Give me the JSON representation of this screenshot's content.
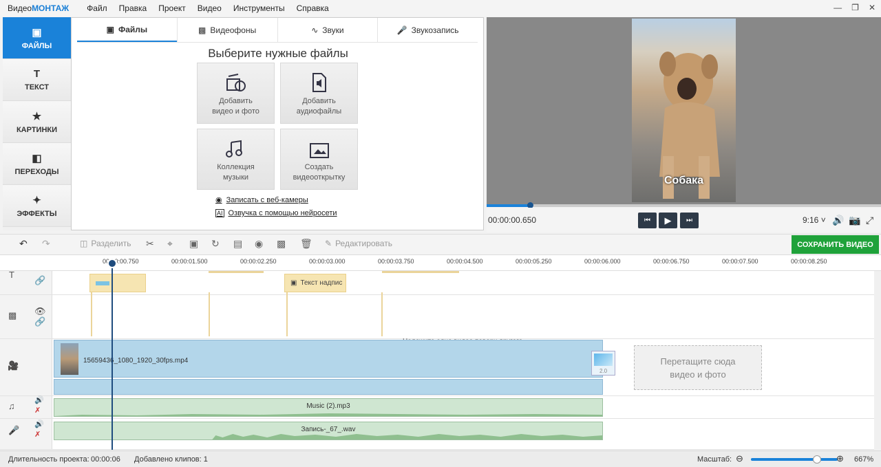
{
  "app": {
    "logo_a": "Видео",
    "logo_b": "МОНТАЖ"
  },
  "menu": [
    "Файл",
    "Правка",
    "Проект",
    "Видео",
    "Инструменты",
    "Справка"
  ],
  "sidetabs": [
    {
      "label": "ФАЙЛЫ",
      "icon": "image-icon"
    },
    {
      "label": "ТЕКСТ",
      "icon": "text-icon"
    },
    {
      "label": "КАРТИНКИ",
      "icon": "star-icon"
    },
    {
      "label": "ПЕРЕХОДЫ",
      "icon": "transition-icon"
    },
    {
      "label": "ЭФФЕКТЫ",
      "icon": "magic-wand-icon"
    }
  ],
  "filetabs": [
    "Файлы",
    "Видеофоны",
    "Звуки",
    "Звукозапись"
  ],
  "files": {
    "title": "Выберите нужные файлы",
    "tiles": [
      {
        "line1": "Добавить",
        "line2": "видео и фото"
      },
      {
        "line1": "Добавить",
        "line2": "аудиофайлы"
      },
      {
        "line1": "Коллекция",
        "line2": "музыки"
      },
      {
        "line1": "Создать",
        "line2": "видеооткрытку"
      }
    ],
    "link_webcam": "Записать с веб-камеры",
    "link_voice": "Озвучка с помощью нейросети"
  },
  "preview": {
    "caption": "Собака",
    "timecode": "00:00:00.650",
    "ratio": "9:16",
    "progress": 0.11
  },
  "toolbar": {
    "split": "Разделить",
    "edit": "Редактировать",
    "save": "СОХРАНИТЬ ВИДЕО"
  },
  "ruler": [
    "00:00:00.750",
    "00:00:01.500",
    "00:00:02.250",
    "00:00:03.000",
    "00:00:03.750",
    "00:00:04.500",
    "00:00:05.250",
    "00:00:06.000",
    "00:00:06.750",
    "00:00:07.500",
    "00:00:08.250"
  ],
  "tracks": {
    "text_clip": "Текст надпис",
    "overlay_hint": "Наложите одно видео поверх другого",
    "video_clip": "15659436_1080_1920_30fps.mp4",
    "transition_value": "2.0",
    "drop_line1": "Перетащите сюда",
    "drop_line2": "видео и фото",
    "music_clip": "Music (2).mp3",
    "voice_clip": "Запись-_67_.wav"
  },
  "status": {
    "duration_label": "Длительность проекта:",
    "duration": "00:00:06",
    "clips": "Добавлено клипов: 1",
    "zoom_label": "Масштаб:",
    "zoom": "667%"
  }
}
